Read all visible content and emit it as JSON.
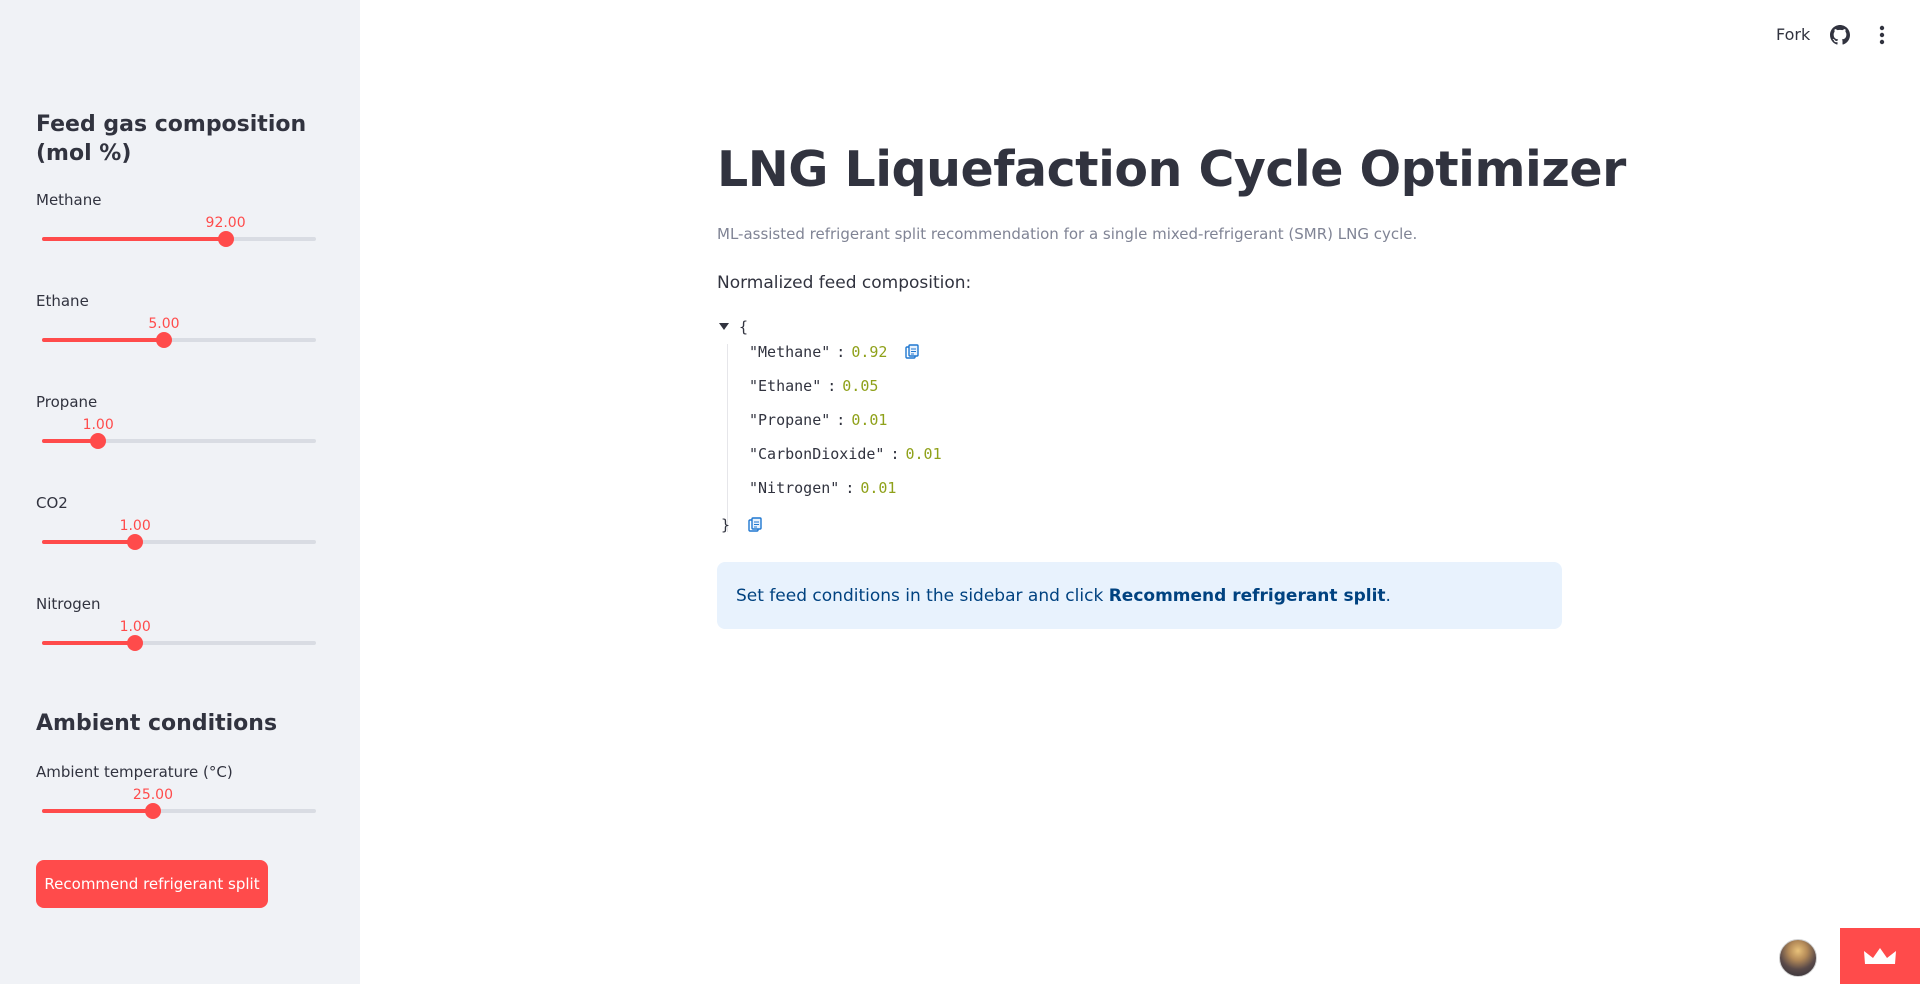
{
  "sidebar": {
    "feed_header": "Feed gas composition (mol %)",
    "sliders": [
      {
        "label": "Methane",
        "value_text": "92.00",
        "fraction": 0.67
      },
      {
        "label": "Ethane",
        "value_text": "5.00",
        "fraction": 0.445
      },
      {
        "label": "Propane",
        "value_text": "1.00",
        "fraction": 0.205
      },
      {
        "label": "CO2",
        "value_text": "1.00",
        "fraction": 0.34
      },
      {
        "label": "Nitrogen",
        "value_text": "1.00",
        "fraction": 0.34
      }
    ],
    "ambient_header": "Ambient conditions",
    "ambient_slider": {
      "label": "Ambient temperature (°C)",
      "value_text": "25.00",
      "fraction": 0.405
    },
    "button_label": "Recommend refrigerant split"
  },
  "toolbar": {
    "fork_label": "Fork",
    "github_icon": "github-icon",
    "menu_icon": "more-vertical-icon"
  },
  "main": {
    "title": "LNG Liquefaction Cycle Optimizer",
    "caption": "ML-assisted refrigerant split recommendation for a single mixed-refrigerant (SMR) LNG cycle.",
    "section_label": "Normalized feed composition:",
    "json_view": {
      "open_brace": "{",
      "close_brace": "}",
      "entries": [
        {
          "key": "\"Methane\"",
          "value": "0.92"
        },
        {
          "key": "\"Ethane\"",
          "value": "0.05"
        },
        {
          "key": "\"Propane\"",
          "value": "0.01"
        },
        {
          "key": "\"CarbonDioxide\"",
          "value": "0.01"
        },
        {
          "key": "\"Nitrogen\"",
          "value": "0.01"
        }
      ]
    },
    "info": {
      "prefix": "Set feed conditions in the sidebar and click ",
      "bold": "Recommend refrigerant split",
      "suffix": "."
    }
  },
  "colors": {
    "accent": "#ff4b4b",
    "sidebar_bg": "#f0f2f6",
    "info_bg": "#e8f2fd",
    "info_text": "#004280",
    "json_number": "#8fa11a"
  }
}
